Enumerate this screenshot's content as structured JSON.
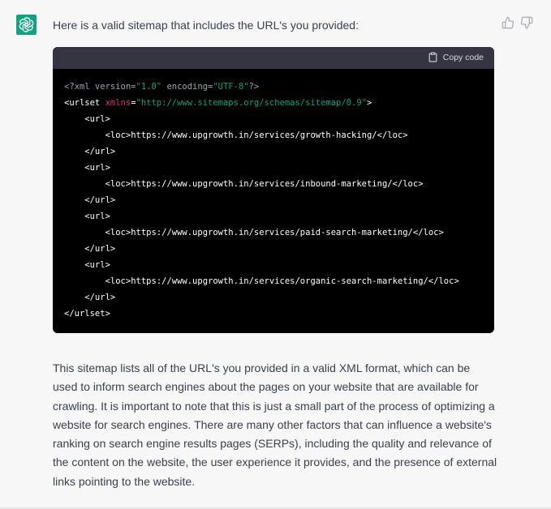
{
  "assistant": {
    "avatar_icon": "openai-logo-icon",
    "avatar_color": "#10a37f"
  },
  "message": {
    "intro": "Here is a valid sitemap that includes the URL's you provided:",
    "feedback": {
      "thumbs_up_icon": "thumbs-up-icon",
      "thumbs_down_icon": "thumbs-down-icon"
    },
    "code_block": {
      "copy_label": "Copy code",
      "copy_icon": "clipboard-icon",
      "lines": [
        [
          {
            "t": "pi",
            "v": "<?xml version="
          },
          {
            "t": "str",
            "v": "\"1.0\""
          },
          {
            "t": "pi",
            "v": " encoding="
          },
          {
            "t": "str",
            "v": "\"UTF-8\""
          },
          {
            "t": "pi",
            "v": "?>"
          }
        ],
        [
          {
            "t": "tag",
            "v": "<urlset "
          },
          {
            "t": "attr",
            "v": "xmlns"
          },
          {
            "t": "tag",
            "v": "="
          },
          {
            "t": "str",
            "v": "\"http://www.sitemaps.org/schemas/sitemap/0.9\""
          },
          {
            "t": "tag",
            "v": ">"
          }
        ],
        [
          {
            "t": "tag",
            "v": "    <url>"
          }
        ],
        [
          {
            "t": "tag",
            "v": "        <loc>"
          },
          {
            "t": "text",
            "v": "https://www.upgrowth.in/services/growth-hacking/"
          },
          {
            "t": "tag",
            "v": "</loc>"
          }
        ],
        [
          {
            "t": "tag",
            "v": "    </url>"
          }
        ],
        [
          {
            "t": "tag",
            "v": "    <url>"
          }
        ],
        [
          {
            "t": "tag",
            "v": "        <loc>"
          },
          {
            "t": "text",
            "v": "https://www.upgrowth.in/services/inbound-marketing/"
          },
          {
            "t": "tag",
            "v": "</loc>"
          }
        ],
        [
          {
            "t": "tag",
            "v": "    </url>"
          }
        ],
        [
          {
            "t": "tag",
            "v": "    <url>"
          }
        ],
        [
          {
            "t": "tag",
            "v": "        <loc>"
          },
          {
            "t": "text",
            "v": "https://www.upgrowth.in/services/paid-search-marketing/"
          },
          {
            "t": "tag",
            "v": "</loc>"
          }
        ],
        [
          {
            "t": "tag",
            "v": "    </url>"
          }
        ],
        [
          {
            "t": "tag",
            "v": "    <url>"
          }
        ],
        [
          {
            "t": "tag",
            "v": "        <loc>"
          },
          {
            "t": "text",
            "v": "https://www.upgrowth.in/services/organic-search-marketing/"
          },
          {
            "t": "tag",
            "v": "</loc>"
          }
        ],
        [
          {
            "t": "tag",
            "v": "    </url>"
          }
        ],
        [
          {
            "t": "tag",
            "v": "</urlset>"
          }
        ]
      ]
    },
    "explanation": "This sitemap lists all of the URL's you provided in a valid XML format, which can be used to inform search engines about the pages on your website that are available for crawling. It is important to note that this is just a small part of the process of optimizing a website for search engines. There are many other factors that can influence a website's ranking on search engine results pages (SERPs), including the quality and relevance of the content on the website, the user experience it provides, and the presence of external links pointing to the website."
  }
}
